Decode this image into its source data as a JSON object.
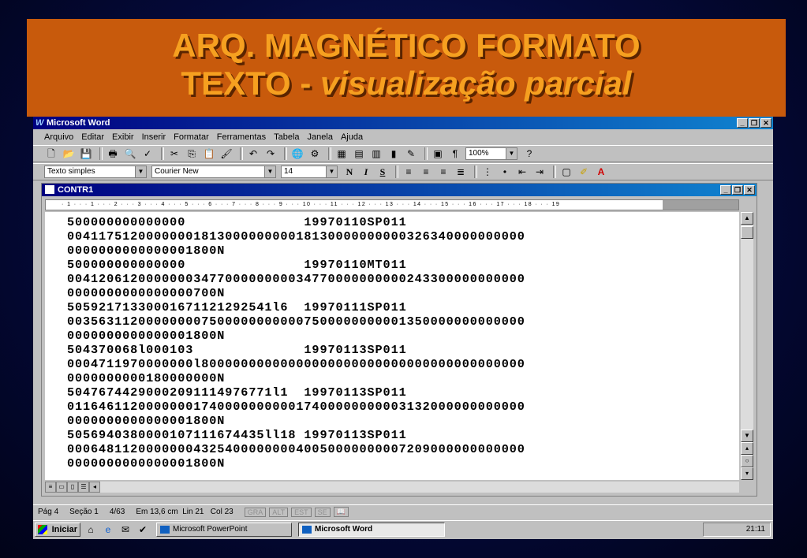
{
  "slide": {
    "title_line1": "ARQ. MAGNÉTICO FORMATO",
    "title_line2_plain": "TEXTO - ",
    "title_line2_italic": "visualização parcial"
  },
  "app": {
    "title": "Microsoft Word",
    "menu": [
      "Arquivo",
      "Editar",
      "Exibir",
      "Inserir",
      "Formatar",
      "Ferramentas",
      "Tabela",
      "Janela",
      "Ajuda"
    ],
    "zoom": "100%",
    "style": "Texto simples",
    "font": "Courier New",
    "font_size": "14"
  },
  "document": {
    "title": "CONTR1",
    "ruler": "· 1 · · · 1 · · · 2 · · · 3 · · · 4 · · · 5 · · · 6 · · · 7 · · · 8 · · · 9 · · · 10 · · · 11 · · · 12 · · · 13 · · · 14 · · · 15 · · · 16 · · · 17 · · · 18 · · · 19",
    "lines": [
      "500000000000000               19970110SP011",
      "0041175120000000181300000000018130000000000326340000000000",
      "0000000000000001800N",
      "500000000000000               19970110MT011",
      "0041206120000000347700000000034770000000000243300000000000",
      "0000000000000000700N",
      "50592171330001671121292541l6  19970111SP011",
      "0035631120000000075000000000007500000000001350000000000000",
      "0000000000000001800N",
      "504370068l000103              19970113SP011",
      "0004711970000000l80000000000000000000000000000000000000000",
      "0000000000180000000N",
      "50476744290002091114976771l1  19970113SP011",
      "0116461120000000174000000000017400000000003132000000000000",
      "0000000000000001800N",
      "5056940380000107111674435ll18 19970113SP011",
      "0006481120000000432540000000040050000000007209000000000000",
      "0000000000000001800N"
    ]
  },
  "status": {
    "page": "Pág 4",
    "section": "Seção 1",
    "pages": "4/63",
    "position": "Em 13,6 cm  Lin 21   Col 23",
    "modes": [
      "GRA",
      "ALT",
      "EST",
      "SE"
    ]
  },
  "taskbar": {
    "start": "Iniciar",
    "tasks": [
      "Microsoft PowerPoint",
      "Microsoft Word"
    ],
    "clock": "21:11"
  }
}
